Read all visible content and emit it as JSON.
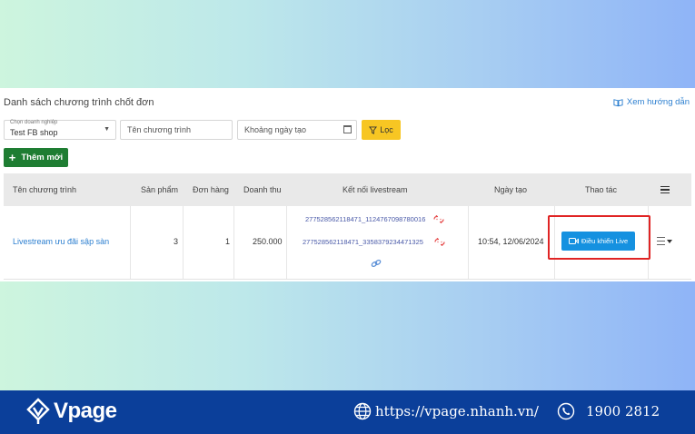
{
  "page": {
    "title": "Danh sách chương trình chốt đơn",
    "guide_link": "Xem hướng dẫn"
  },
  "filters": {
    "business_label": "Chọn doanh nghiệp",
    "business_value": "Test FB shop",
    "program_placeholder": "Tên chương trình",
    "date_placeholder": "Khoảng ngày tạo",
    "filter_button": "Lọc"
  },
  "actions": {
    "add_button": "Thêm mới"
  },
  "table": {
    "headers": [
      "Tên chương trình",
      "Sản phẩm",
      "Đơn hàng",
      "Doanh thu",
      "Kết nối livestream",
      "Ngày tạo",
      "Thao tác"
    ],
    "rows": [
      {
        "name": "Livestream ưu đãi sập sàn",
        "products": "3",
        "orders": "1",
        "revenue": "250.000",
        "livestreams": [
          "277528562118471_1124767098780016",
          "277528562118471_3358379234471325"
        ],
        "created": "10:54, 12/06/2024",
        "action_label": "Điều khiển Live"
      }
    ]
  },
  "footer": {
    "brand": "Vpage",
    "website": "https://vpage.nhanh.vn/",
    "phone": "1900 2812"
  },
  "colors": {
    "accent_blue": "#1591e0",
    "filter_yellow": "#f7c623",
    "add_green": "#1e7d32",
    "highlight_red": "#e02424",
    "footer_navy": "#0b3f9a"
  },
  "icons": [
    "book-icon",
    "calendar-icon",
    "filter-icon",
    "plus-icon",
    "menu-icon",
    "broken-link-icon",
    "link-icon",
    "video-camera-icon",
    "caret-down-icon",
    "globe-icon",
    "phone-icon"
  ]
}
